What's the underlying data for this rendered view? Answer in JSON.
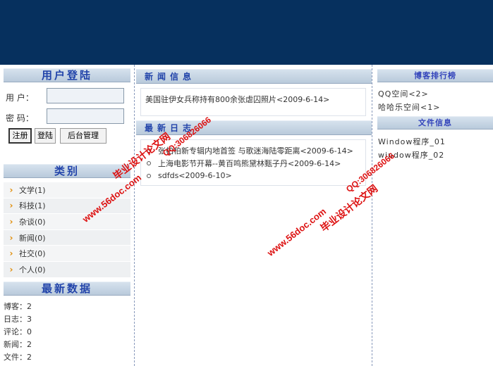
{
  "login": {
    "title": "用户登陆",
    "user_label": "用  户：",
    "password_label": "密  码：",
    "username_value": "",
    "password_value": "",
    "register_label": "注册",
    "login_label": "登陆",
    "admin_label": "后台管理"
  },
  "categories": {
    "title": "类别",
    "items": [
      {
        "label": "文学(1)"
      },
      {
        "label": "科技(1)"
      },
      {
        "label": "杂谈(0)"
      },
      {
        "label": "新闻(0)"
      },
      {
        "label": "社交(0)"
      },
      {
        "label": "个人(0)"
      }
    ]
  },
  "latest": {
    "title": "最新数据",
    "lines": [
      "博客：2",
      "日志：3",
      "评论：0",
      "新闻：2",
      "文件：2"
    ]
  },
  "news": {
    "title": "新闻信息",
    "items": [
      "美国驻伊女兵称持有800余张虐囚照片<2009-6-14>"
    ]
  },
  "blogs": {
    "title": "最新日志",
    "items": [
      "张柏柏新专辑内地首签 与歌迷海陆零距离<2009-6-14>",
      "上海电影节开幕--黄百鸣熊黛林甄子丹<2009-6-14>",
      "sdfds<2009-6-10>"
    ]
  },
  "ranking": {
    "title": "博客排行榜",
    "items": [
      "QQ空间<2>",
      "哈哈乐空间<1>"
    ]
  },
  "files": {
    "title": "文件信息",
    "items": [
      "Window程序_01",
      "window程序_02"
    ]
  },
  "watermarks": {
    "site": "www.56doc.com",
    "qq": "QQ:306826066",
    "name": "毕业设计论文网"
  },
  "colors": {
    "banner": "#06305e",
    "heading_text": "#2244aa",
    "watermark": "#dd1111",
    "arrow": "#e08a00"
  }
}
